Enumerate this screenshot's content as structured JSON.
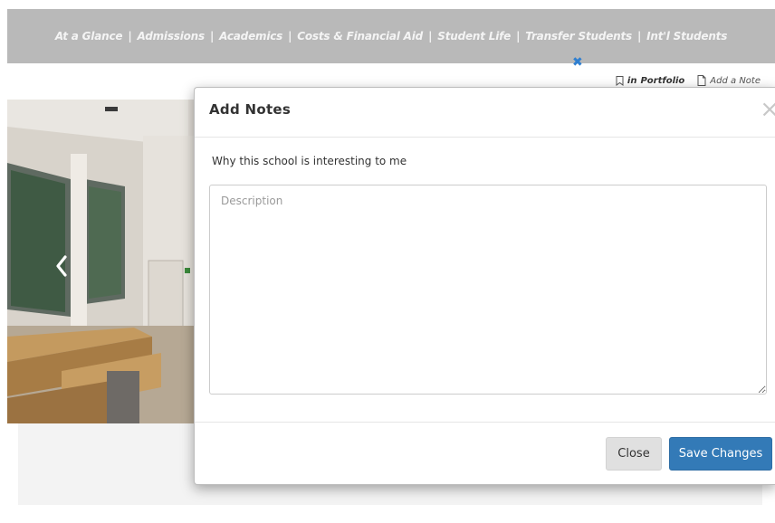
{
  "nav": {
    "items": [
      "At a Glance",
      "Admissions",
      "Academics",
      "Costs & Financial Aid",
      "Student Life",
      "Transfer Students",
      "Int'l Students"
    ],
    "separator": "|"
  },
  "portfolio_bar": {
    "in_label": "in",
    "portfolio_label": "Portfolio",
    "add_note_label": "Add a Note"
  },
  "modal": {
    "title": "Add Notes",
    "close_glyph": "×",
    "field_label": "Why this school is interesting to me",
    "description_placeholder": "Description",
    "description_value": "",
    "close_button": "Close",
    "save_button": "Save Changes"
  },
  "colors": {
    "nav_bg": "#b9b9b9",
    "primary": "#337ab7",
    "accent_mark": "#2f7fd0"
  },
  "icons": {
    "pin": "x-mark-icon",
    "bookmark": "bookmark-icon",
    "note": "document-icon",
    "carousel_prev": "chevron-left-icon"
  }
}
